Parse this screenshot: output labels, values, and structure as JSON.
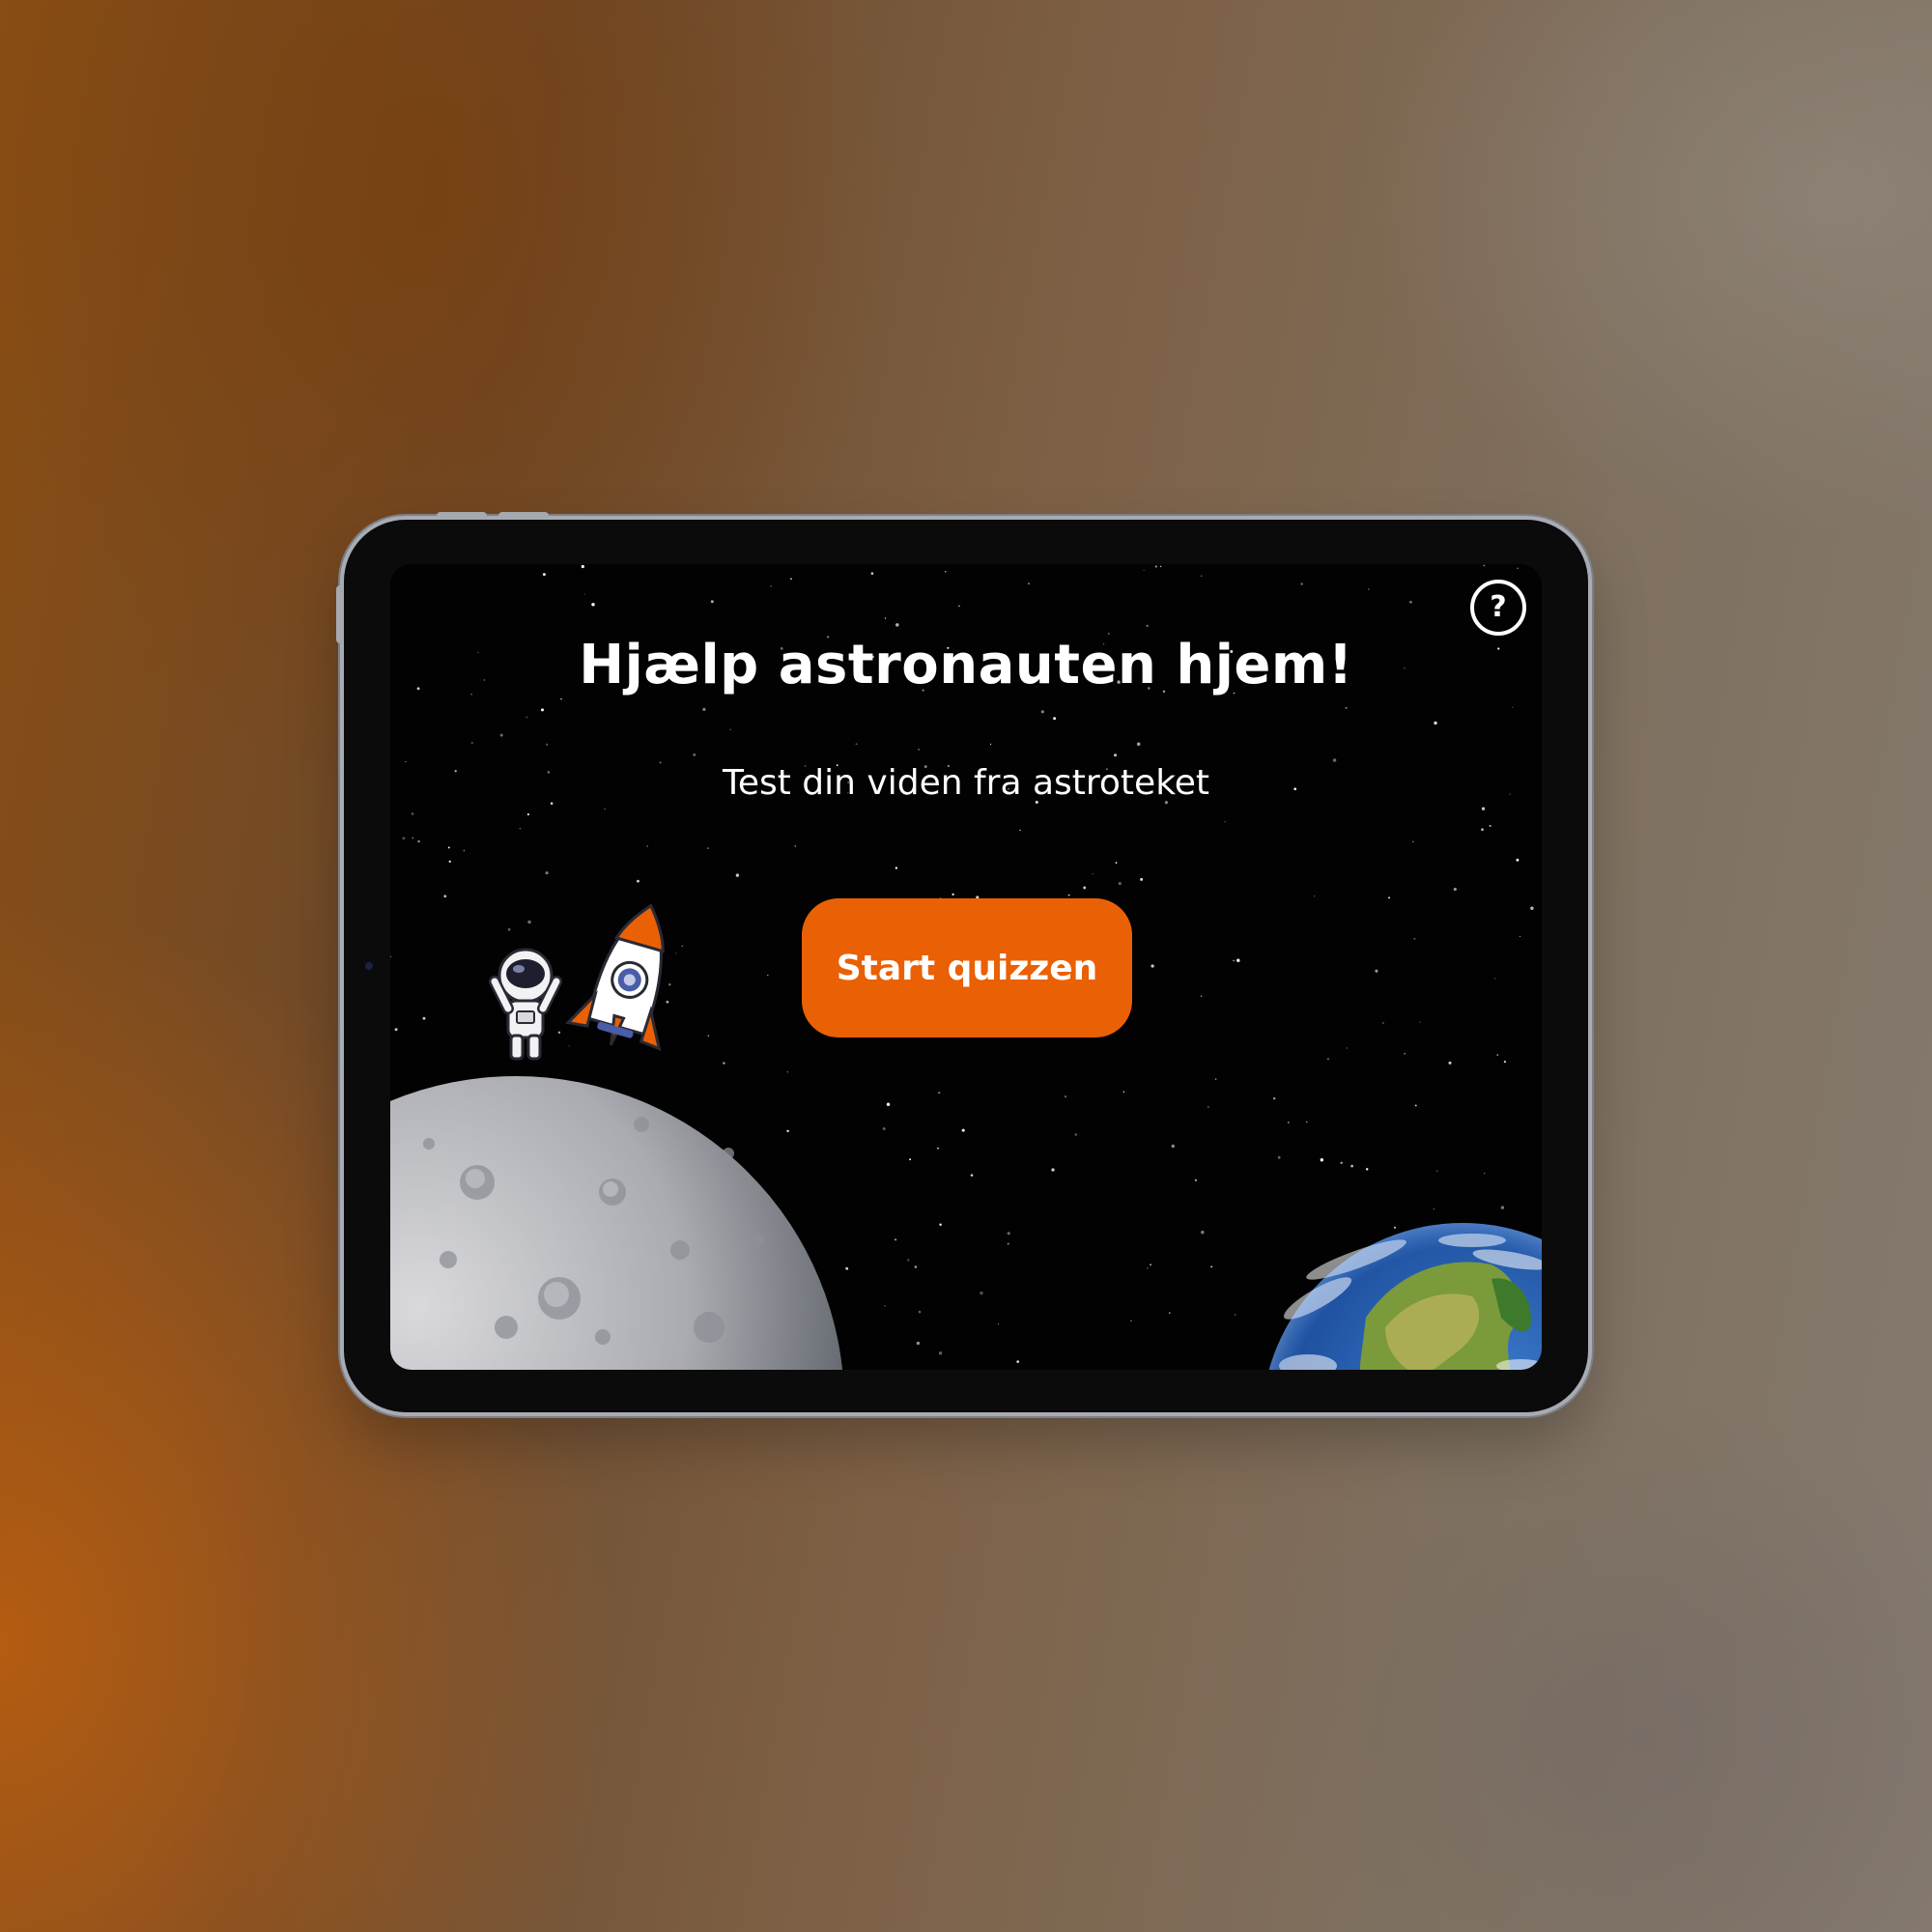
{
  "screen": {
    "title": "Hjælp astronauten hjem!",
    "subtitle": "Test din viden fra astroteket",
    "start_button_label": "Start quizzen",
    "help_button_label": "?",
    "help_icon": "question-circle-icon"
  },
  "colors": {
    "accent": "#ea6005",
    "screen_background": "#020202",
    "text": "#ffffff"
  },
  "illustrations": [
    "moon",
    "astronaut",
    "rocket",
    "earth"
  ]
}
